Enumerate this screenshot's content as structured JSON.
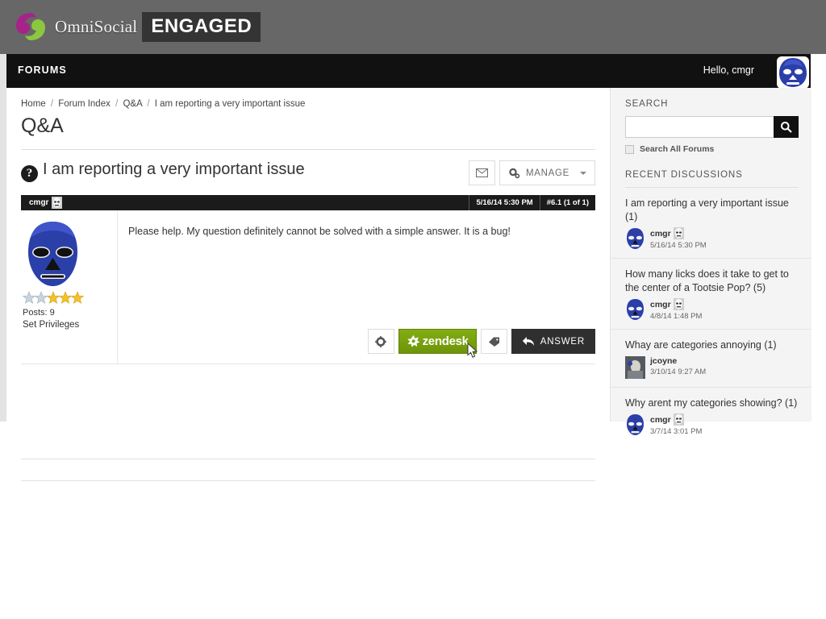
{
  "brand": {
    "name": "OmniSocial",
    "badge": "ENGAGED",
    "logo_colors": {
      "top": "#a6248a",
      "bottom": "#8dc63f"
    }
  },
  "navbar": {
    "title": "FORUMS",
    "greeting": "Hello, cmgr",
    "avatar_name": "luchador-mask-avatar",
    "background": "#111111"
  },
  "breadcrumb": {
    "items": [
      "Home",
      "Forum Index",
      "Q&A",
      "I am reporting a very important issue"
    ],
    "separator": "/"
  },
  "page": {
    "title": "Q&A"
  },
  "thread": {
    "icon": "question-mark-icon",
    "title": "I am reporting a very important issue",
    "mail_button_label": "",
    "manage_button_label": "MANAGE",
    "post": {
      "bar_username": "cmgr",
      "date": "5/16/14 5:30 PM",
      "number": "#6.1 (1 of 1)",
      "author": {
        "posts_label": "Posts: 9",
        "privileges_label": "Set Privileges",
        "stars": [
          "gray",
          "gray",
          "gold",
          "gold",
          "gold"
        ]
      },
      "body": "Please help. My question definitely cannot be solved with a simple answer. It is a bug!",
      "actions": {
        "settings_label": "",
        "zendesk_label": "zendesk",
        "tag_label": "",
        "answer_label": "ANSWER",
        "zendesk_color": "#7aa40f",
        "answer_color": "#2f2f2f"
      }
    }
  },
  "sidebar": {
    "search": {
      "heading": "SEARCH",
      "value": "",
      "placeholder": "",
      "button_icon": "search-icon",
      "all_forums_label": "Search All Forums",
      "all_forums_checked": false
    },
    "recent": {
      "heading": "RECENT DISCUSSIONS",
      "items": [
        {
          "title": "I am reporting a very important issue (1)",
          "author": "cmgr",
          "date": "5/16/14 5:30 PM",
          "avatar": "blue-mask"
        },
        {
          "title": "How many licks does it take to get to the center of a Tootsie Pop? (5)",
          "author": "cmgr",
          "date": "4/8/14 1:48 PM",
          "avatar": "blue-mask"
        },
        {
          "title": "Whay are categories annoying (1)",
          "author": "jcoyne",
          "date": "3/10/14 9:27 AM",
          "avatar": "photo"
        },
        {
          "title": "Why arent my categories showing? (1)",
          "author": "cmgr",
          "date": "3/7/14 3:01 PM",
          "avatar": "blue-mask"
        }
      ]
    }
  }
}
